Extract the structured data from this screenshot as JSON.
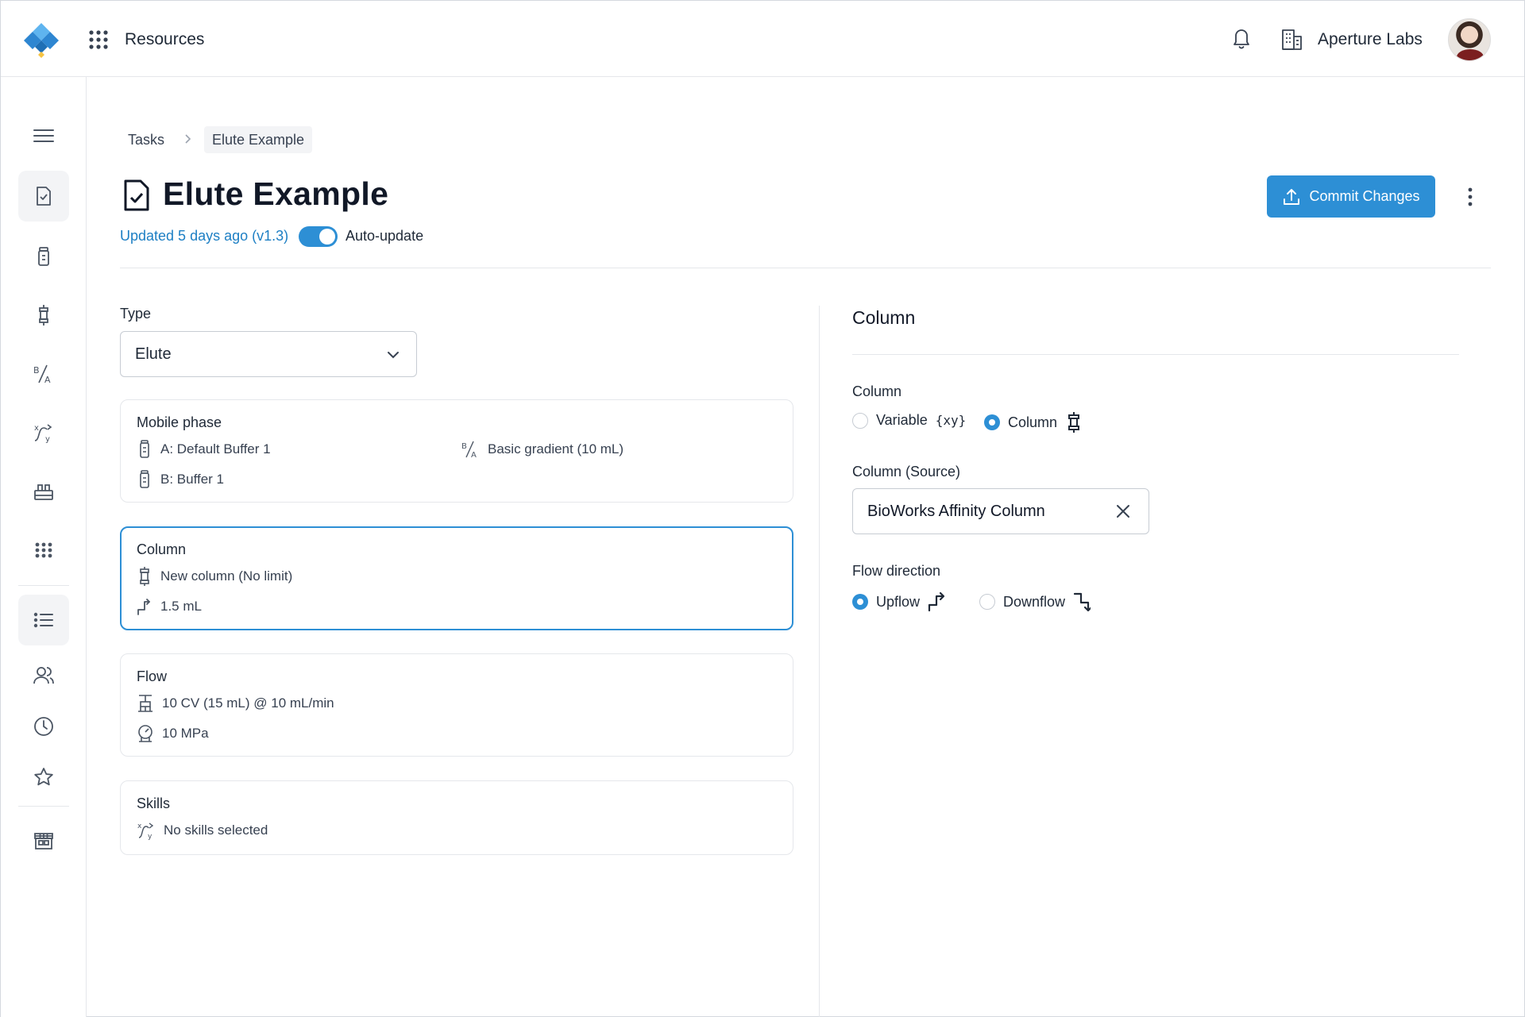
{
  "topbar": {
    "section": "Resources",
    "org_name": "Aperture Labs"
  },
  "breadcrumb": {
    "items": [
      "Tasks",
      "Elute Example"
    ]
  },
  "page": {
    "title": "Elute Example",
    "updated": "Updated 5 days ago (v1.3)",
    "auto_update_label": "Auto-update",
    "auto_update_on": true,
    "commit_label": "Commit Changes"
  },
  "type_field": {
    "label": "Type",
    "value": "Elute"
  },
  "cards": {
    "mobile_phase": {
      "title": "Mobile phase",
      "buffer_a": "A: Default Buffer 1",
      "buffer_b": "B: Buffer 1",
      "gradient": "Basic gradient (10 mL)"
    },
    "column": {
      "title": "Column",
      "column": "New column (No limit)",
      "volume": "1.5 mL"
    },
    "flow": {
      "title": "Flow",
      "rate": "10 CV (15 mL) @ 10 mL/min",
      "pressure": "10 MPa"
    },
    "skills": {
      "title": "Skills",
      "value": "No skills selected"
    }
  },
  "right_panel": {
    "title": "Column",
    "column_label": "Column",
    "option_variable": "Variable",
    "option_variable_glyph": "{xy}",
    "option_column": "Column",
    "selected_column_option": "Column",
    "source_label": "Column (Source)",
    "source_value": "BioWorks Affinity Column",
    "flow_direction_label": "Flow direction",
    "option_upflow": "Upflow",
    "option_downflow": "Downflow",
    "selected_flow": "Upflow"
  },
  "colors": {
    "accent": "#2d8fd5",
    "link": "#1d7fc4",
    "border": "#e5e7eb"
  },
  "icons": {
    "sidebar": [
      "menu-icon",
      "task-icon",
      "buffer-icon",
      "column-icon",
      "gradient-icon",
      "skills-icon",
      "equipment-icon",
      "apps-icon",
      "list-icon",
      "users-icon",
      "clock-icon",
      "star-icon",
      "store-icon"
    ]
  }
}
